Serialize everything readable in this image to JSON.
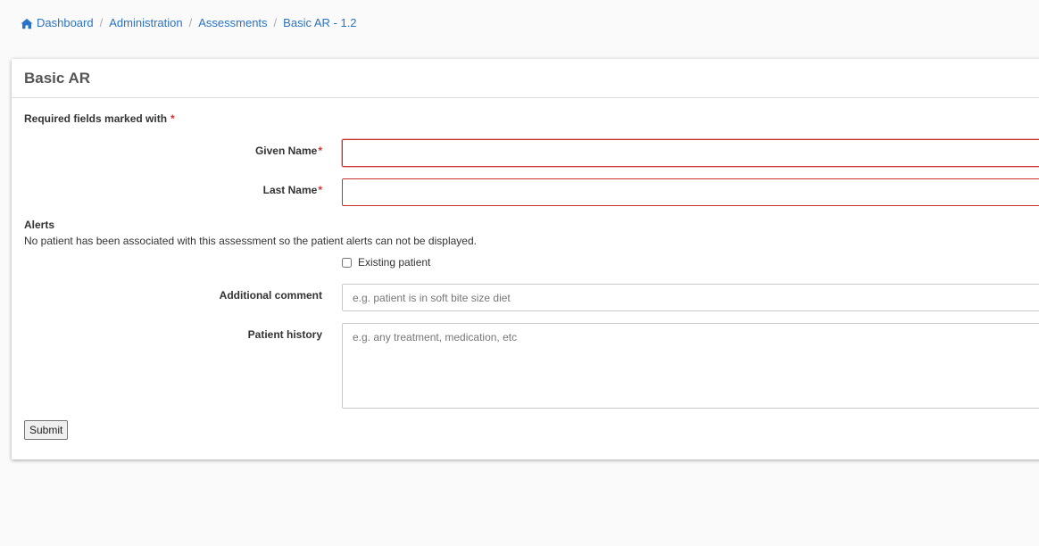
{
  "breadcrumb": {
    "items": [
      "Dashboard",
      "Administration",
      "Assessments",
      "Basic AR - 1.2"
    ],
    "separator": "/"
  },
  "card": {
    "title": "Basic AR",
    "required_note": "Required fields marked with",
    "required_star": "*"
  },
  "form": {
    "given_name_label": "Given Name",
    "given_name_value": "",
    "last_name_label": "Last Name",
    "last_name_value": "",
    "star": "*",
    "alerts_title": "Alerts",
    "alerts_text": "No patient has been associated with this assessment so the patient alerts can not be displayed.",
    "existing_patient_label": "Existing patient",
    "existing_patient_checked": false,
    "additional_comment_label": "Additional comment",
    "additional_comment_placeholder": "e.g. patient is in soft bite size diet",
    "patient_history_label": "Patient history",
    "patient_history_placeholder": "e.g. any treatment, medication, etc",
    "submit_label": "Submit"
  },
  "colors": {
    "link": "#2a72c9",
    "required": "#d9302c",
    "invalid_border": "#c9302c",
    "background": "#fafafa"
  },
  "icons": {
    "home": "home-icon"
  }
}
